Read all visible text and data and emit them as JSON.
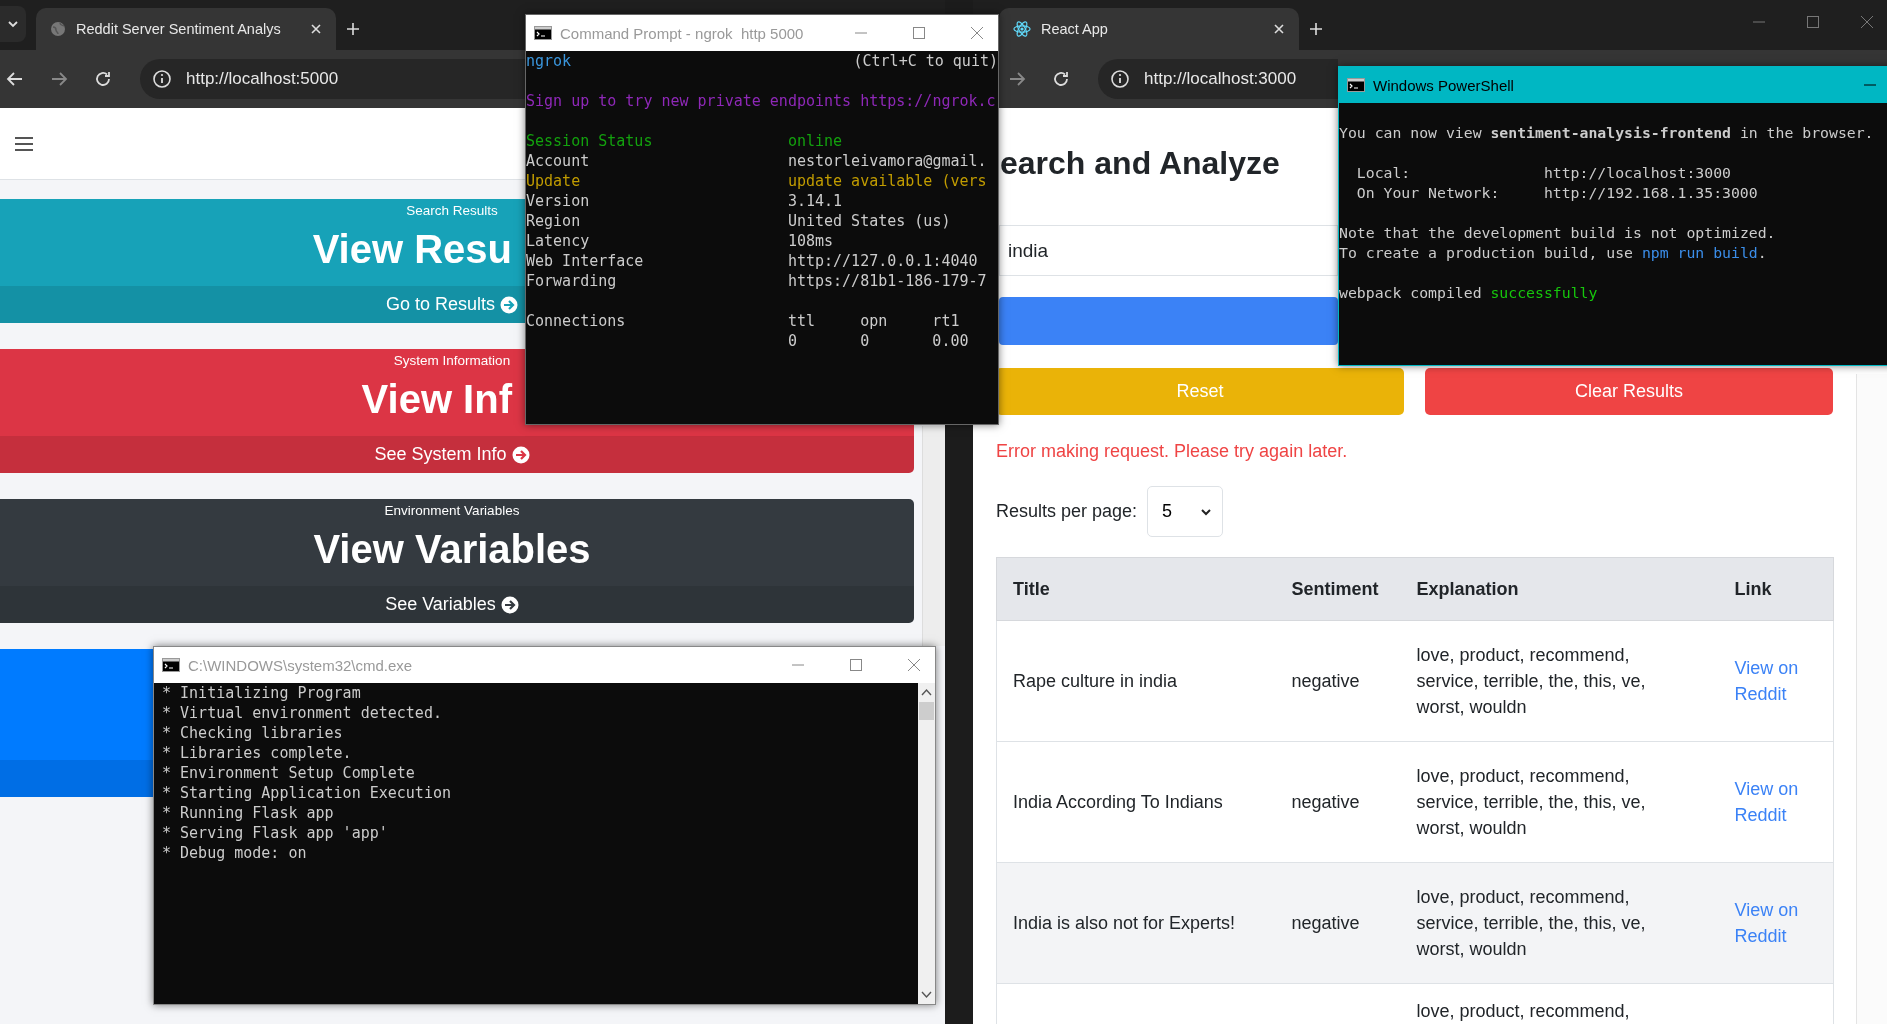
{
  "left_browser": {
    "tab": {
      "title": "Reddit Server Sentiment Analys",
      "selected": true
    },
    "url": "http://localhost:5000",
    "cards": [
      {
        "label": "Search Results",
        "title": "View Resu",
        "action": "Go to Results",
        "color": "#17a2b8"
      },
      {
        "label": "System Information",
        "title": "View Inf",
        "action": "See System Info",
        "color": "#dc3545"
      },
      {
        "label": "Environment Variables",
        "title": "View Variables",
        "action": "See Variables",
        "color": "#343a40"
      },
      {
        "color": "#007bff"
      }
    ]
  },
  "right_browser": {
    "tab": {
      "title": "React App",
      "selected": true
    },
    "url": "http://localhost:3000",
    "heading": "earch and Analyze",
    "search": {
      "value": "india"
    },
    "buttons": [
      {
        "label": "Reset",
        "kind": "warning"
      },
      {
        "label": "Clear Results",
        "kind": "danger"
      }
    ],
    "error": "Error making request. Please try again later.",
    "per_page": {
      "label": "Results per page:",
      "value": "5"
    },
    "table": {
      "columns": [
        "Title",
        "Sentiment",
        "Explanation",
        "Link"
      ],
      "rows": [
        {
          "title": "Rape culture in india",
          "sentiment": "negative",
          "explanation": "love, product, recommend, service, terrible, the, this, ve, worst, wouldn",
          "link": "View on Reddit",
          "highlighted": false
        },
        {
          "title": "India According To Indians",
          "sentiment": "negative",
          "explanation": "love, product, recommend, service, terrible, the, this, ve, worst, wouldn",
          "link": "View on Reddit",
          "highlighted": false
        },
        {
          "title": "India is also not for Experts!",
          "sentiment": "negative",
          "explanation": "love, product, recommend, service, terrible, the, this, ve, worst, wouldn",
          "link": "View on Reddit",
          "highlighted": true
        },
        {
          "explanation": "love, product, recommend,",
          "highlighted": false
        }
      ]
    }
  },
  "ngrok_window": {
    "title": "Command Prompt - ngrok  http 5000",
    "active": false,
    "app": "ngrok",
    "quit_hint": "(Ctrl+C to quit)",
    "banner": "Sign up to try new private endpoints https://ngrok.c",
    "status": [
      {
        "label": "Session Status",
        "value": "online",
        "color": "#13a10e"
      },
      {
        "label": "Account",
        "value": "nestorleivamora@gmail.",
        "color": "#cccccc"
      },
      {
        "label": "Update",
        "value": "update available (vers",
        "color": "#c19c00"
      },
      {
        "label": "Version",
        "value": "3.14.1",
        "color": "#cccccc"
      },
      {
        "label": "Region",
        "value": "United States (us)",
        "color": "#cccccc"
      },
      {
        "label": "Latency",
        "value": "108ms",
        "color": "#cccccc"
      },
      {
        "label": "Web Interface",
        "value": "http://127.0.0.1:4040",
        "color": "#cccccc"
      },
      {
        "label": "Forwarding",
        "value": "https://81b1-186-179-7",
        "color": "#cccccc"
      }
    ],
    "connections": {
      "label": "Connections",
      "columns": [
        {
          "heading": "ttl",
          "value": "0"
        },
        {
          "heading": "opn",
          "value": "0"
        },
        {
          "heading": "rt1",
          "value": "0.00"
        }
      ]
    }
  },
  "cmd_window": {
    "title": "C:\\WINDOWS\\system32\\cmd.exe",
    "active": false,
    "lines": [
      "* Initializing Program",
      "* Virtual environment detected.",
      "* Checking libraries",
      "* Libraries complete.",
      "* Environment Setup Complete",
      "* Starting Application Execution",
      "* Running Flask app",
      "* Serving Flask app 'app'",
      "* Debug mode: on"
    ]
  },
  "powershell": {
    "title": "Windows PowerShell",
    "active": true,
    "lines": [
      {
        "kind": "blank"
      },
      {
        "kind": "text",
        "segments": [
          {
            "text": "You can now view **sentiment-analysis-frontend** in the browser."
          }
        ]
      },
      {
        "kind": "blank"
      },
      {
        "kind": "pair",
        "label": "Local:",
        "value": "http://localhost:3000"
      },
      {
        "kind": "pair",
        "label": "On Your Network:",
        "value": "http://192.168.1.35:3000"
      },
      {
        "kind": "blank"
      },
      {
        "kind": "text",
        "segments": [
          {
            "text": "Note that the development build is not optimized."
          }
        ]
      },
      {
        "kind": "text",
        "segments": [
          {
            "text": "To create a production build, use "
          },
          {
            "text": "npm run build",
            "color": "#3b8eea"
          },
          {
            "text": "."
          }
        ]
      },
      {
        "kind": "blank"
      },
      {
        "kind": "text",
        "segments": [
          {
            "text": "webpack compiled "
          },
          {
            "text": "successfully",
            "color": "#16c60c"
          }
        ]
      }
    ]
  }
}
